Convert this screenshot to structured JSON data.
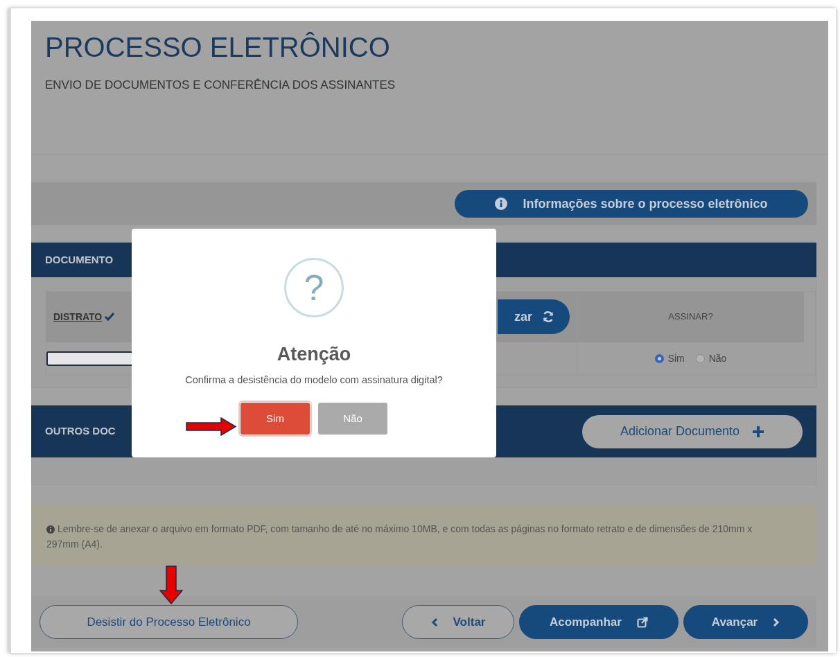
{
  "page": {
    "title": "PROCESSO ELETRÔNICO",
    "subtitle": "ENVIO DE DOCUMENTOS E CONFERÊNCIA DOS ASSINANTES"
  },
  "info_button": "Informações sobre o processo eletrônico",
  "documents": {
    "header": "DOCUMENTO",
    "document": {
      "name": "DISTRATO",
      "checked": true
    },
    "action_button": "zar",
    "sign_column": "ASSINAR?",
    "sign_options": [
      {
        "label": "Sim",
        "selected": true
      },
      {
        "label": "Não",
        "selected": false
      }
    ]
  },
  "other_documents": {
    "header": "OUTROS DOC",
    "add_button": "Adicionar Documento"
  },
  "notice": "Lembre-se de anexar o arquivo em formato PDF, com tamanho de até no máximo 10MB, e com todas as páginas no formato retrato e de dimensões de 210mm x 297mm (A4).",
  "footer": {
    "quit_button": "Desistir do Processo Eletrônico",
    "buttons": [
      {
        "label": "Voltar",
        "kind": "back"
      },
      {
        "label": "Acompanhar",
        "kind": "follow"
      },
      {
        "label": "Avançar",
        "kind": "next"
      }
    ]
  },
  "dialog": {
    "icon": "?",
    "title": "Atenção",
    "message": "Confirma a desistência do modelo com assinatura digital?",
    "buttons": [
      {
        "label": "Sim",
        "kind": "confirm"
      },
      {
        "label": "Não",
        "kind": "cancel"
      }
    ]
  }
}
